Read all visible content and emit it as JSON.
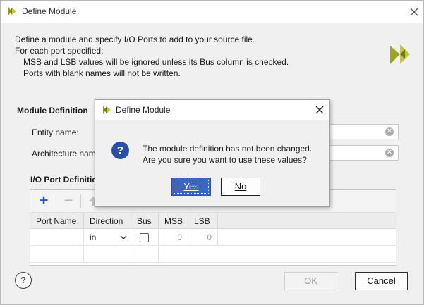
{
  "window": {
    "title": "Define Module",
    "description": {
      "line1": "Define a module and specify I/O Ports to add to your source file.",
      "line2": "For each port specified:",
      "line3": "MSB and LSB values will be ignored unless its Bus column is checked.",
      "line4": "Ports with blank names will not be written."
    }
  },
  "module_definition": {
    "section_title": "Module Definition",
    "entity_label": "Entity name:",
    "architecture_label": "Architecture nam"
  },
  "io_ports": {
    "section_title": "I/O Port Definitio",
    "columns": [
      "Port Name",
      "Direction",
      "Bus",
      "MSB",
      "LSB"
    ],
    "rows": [
      {
        "port_name": "",
        "direction": "in",
        "bus": false,
        "msb": "0",
        "lsb": "0"
      }
    ]
  },
  "footer": {
    "help_label": "?",
    "ok_label": "OK",
    "cancel_label": "Cancel"
  },
  "dialog": {
    "title": "Define Module",
    "message_line1": "The module definition has not been changed.",
    "message_line2": "Are you sure you want to use these values?",
    "yes_label": "Yes",
    "no_label": "No"
  },
  "colors": {
    "accent_blue": "#3a66c0",
    "question_icon": "#2b4fa0",
    "logo_green": "#8a9a1f",
    "logo_yellow": "#c9c53a"
  },
  "icons": [
    "app-logo-icon",
    "close-icon",
    "clear-icon",
    "add-icon",
    "remove-icon",
    "move-up-icon",
    "chevron-down-icon",
    "question-icon",
    "help-icon"
  ]
}
